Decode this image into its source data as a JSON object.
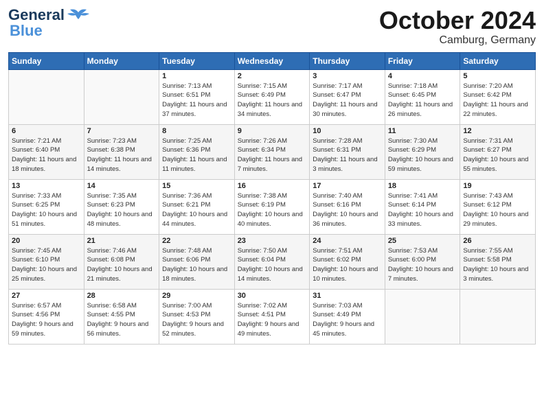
{
  "header": {
    "logo_line1": "General",
    "logo_line2": "Blue",
    "month": "October 2024",
    "location": "Camburg, Germany"
  },
  "weekdays": [
    "Sunday",
    "Monday",
    "Tuesday",
    "Wednesday",
    "Thursday",
    "Friday",
    "Saturday"
  ],
  "weeks": [
    [
      {
        "day": "",
        "info": ""
      },
      {
        "day": "",
        "info": ""
      },
      {
        "day": "1",
        "info": "Sunrise: 7:13 AM\nSunset: 6:51 PM\nDaylight: 11 hours\nand 37 minutes."
      },
      {
        "day": "2",
        "info": "Sunrise: 7:15 AM\nSunset: 6:49 PM\nDaylight: 11 hours\nand 34 minutes."
      },
      {
        "day": "3",
        "info": "Sunrise: 7:17 AM\nSunset: 6:47 PM\nDaylight: 11 hours\nand 30 minutes."
      },
      {
        "day": "4",
        "info": "Sunrise: 7:18 AM\nSunset: 6:45 PM\nDaylight: 11 hours\nand 26 minutes."
      },
      {
        "day": "5",
        "info": "Sunrise: 7:20 AM\nSunset: 6:42 PM\nDaylight: 11 hours\nand 22 minutes."
      }
    ],
    [
      {
        "day": "6",
        "info": "Sunrise: 7:21 AM\nSunset: 6:40 PM\nDaylight: 11 hours\nand 18 minutes."
      },
      {
        "day": "7",
        "info": "Sunrise: 7:23 AM\nSunset: 6:38 PM\nDaylight: 11 hours\nand 14 minutes."
      },
      {
        "day": "8",
        "info": "Sunrise: 7:25 AM\nSunset: 6:36 PM\nDaylight: 11 hours\nand 11 minutes."
      },
      {
        "day": "9",
        "info": "Sunrise: 7:26 AM\nSunset: 6:34 PM\nDaylight: 11 hours\nand 7 minutes."
      },
      {
        "day": "10",
        "info": "Sunrise: 7:28 AM\nSunset: 6:31 PM\nDaylight: 11 hours\nand 3 minutes."
      },
      {
        "day": "11",
        "info": "Sunrise: 7:30 AM\nSunset: 6:29 PM\nDaylight: 10 hours\nand 59 minutes."
      },
      {
        "day": "12",
        "info": "Sunrise: 7:31 AM\nSunset: 6:27 PM\nDaylight: 10 hours\nand 55 minutes."
      }
    ],
    [
      {
        "day": "13",
        "info": "Sunrise: 7:33 AM\nSunset: 6:25 PM\nDaylight: 10 hours\nand 51 minutes."
      },
      {
        "day": "14",
        "info": "Sunrise: 7:35 AM\nSunset: 6:23 PM\nDaylight: 10 hours\nand 48 minutes."
      },
      {
        "day": "15",
        "info": "Sunrise: 7:36 AM\nSunset: 6:21 PM\nDaylight: 10 hours\nand 44 minutes."
      },
      {
        "day": "16",
        "info": "Sunrise: 7:38 AM\nSunset: 6:19 PM\nDaylight: 10 hours\nand 40 minutes."
      },
      {
        "day": "17",
        "info": "Sunrise: 7:40 AM\nSunset: 6:16 PM\nDaylight: 10 hours\nand 36 minutes."
      },
      {
        "day": "18",
        "info": "Sunrise: 7:41 AM\nSunset: 6:14 PM\nDaylight: 10 hours\nand 33 minutes."
      },
      {
        "day": "19",
        "info": "Sunrise: 7:43 AM\nSunset: 6:12 PM\nDaylight: 10 hours\nand 29 minutes."
      }
    ],
    [
      {
        "day": "20",
        "info": "Sunrise: 7:45 AM\nSunset: 6:10 PM\nDaylight: 10 hours\nand 25 minutes."
      },
      {
        "day": "21",
        "info": "Sunrise: 7:46 AM\nSunset: 6:08 PM\nDaylight: 10 hours\nand 21 minutes."
      },
      {
        "day": "22",
        "info": "Sunrise: 7:48 AM\nSunset: 6:06 PM\nDaylight: 10 hours\nand 18 minutes."
      },
      {
        "day": "23",
        "info": "Sunrise: 7:50 AM\nSunset: 6:04 PM\nDaylight: 10 hours\nand 14 minutes."
      },
      {
        "day": "24",
        "info": "Sunrise: 7:51 AM\nSunset: 6:02 PM\nDaylight: 10 hours\nand 10 minutes."
      },
      {
        "day": "25",
        "info": "Sunrise: 7:53 AM\nSunset: 6:00 PM\nDaylight: 10 hours\nand 7 minutes."
      },
      {
        "day": "26",
        "info": "Sunrise: 7:55 AM\nSunset: 5:58 PM\nDaylight: 10 hours\nand 3 minutes."
      }
    ],
    [
      {
        "day": "27",
        "info": "Sunrise: 6:57 AM\nSunset: 4:56 PM\nDaylight: 9 hours\nand 59 minutes."
      },
      {
        "day": "28",
        "info": "Sunrise: 6:58 AM\nSunset: 4:55 PM\nDaylight: 9 hours\nand 56 minutes."
      },
      {
        "day": "29",
        "info": "Sunrise: 7:00 AM\nSunset: 4:53 PM\nDaylight: 9 hours\nand 52 minutes."
      },
      {
        "day": "30",
        "info": "Sunrise: 7:02 AM\nSunset: 4:51 PM\nDaylight: 9 hours\nand 49 minutes."
      },
      {
        "day": "31",
        "info": "Sunrise: 7:03 AM\nSunset: 4:49 PM\nDaylight: 9 hours\nand 45 minutes."
      },
      {
        "day": "",
        "info": ""
      },
      {
        "day": "",
        "info": ""
      }
    ]
  ]
}
